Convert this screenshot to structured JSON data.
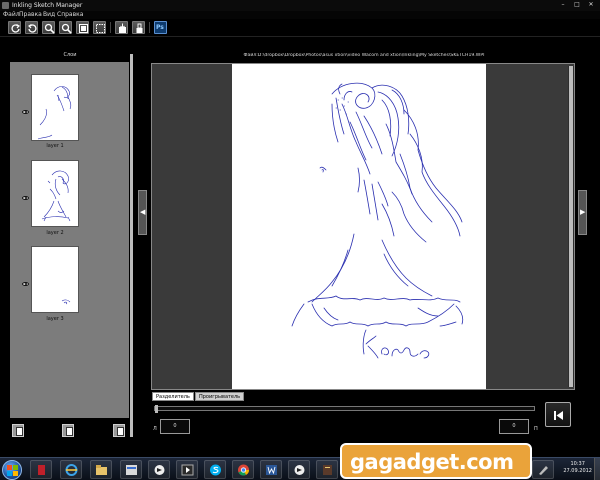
{
  "window": {
    "title": "Inkling Sketch Manager",
    "controls": {
      "minimize": "–",
      "maximize": "□",
      "close": "✕"
    }
  },
  "menu": [
    "Файл",
    "Правка",
    "Вид",
    "Справка"
  ],
  "toolbar": {
    "buttons": [
      {
        "name": "rotate-cw-icon"
      },
      {
        "name": "rotate-ccw-icon"
      },
      {
        "name": "zoom-in-icon"
      },
      {
        "name": "zoom-out-icon"
      },
      {
        "name": "fit-page-icon"
      },
      {
        "name": "actual-size-icon"
      },
      {
        "name": "save-icon"
      },
      {
        "name": "export-icon"
      },
      {
        "name": "photoshop-icon",
        "label": "Ps"
      }
    ]
  },
  "layers_panel": {
    "title": "Слои",
    "layers": [
      {
        "name": "layer 1"
      },
      {
        "name": "layer 2"
      },
      {
        "name": "layer 3"
      }
    ]
  },
  "main": {
    "file_path": "Файл:D:\\dropbox\\Dropbox\\Photos\\asus xtion\\video Wacom and xtion\\Inkling\\My Sketches\\SKETCH19.WPI",
    "tabs": [
      {
        "label": "Разделитель",
        "active": true
      },
      {
        "label": "Проигрыватель",
        "active": false
      }
    ],
    "counter_left": {
      "label": "Л",
      "value": "0"
    },
    "counter_right": {
      "label": "П",
      "value": "0"
    }
  },
  "taskbar": {
    "time": "10:37",
    "date": "27.09.2012",
    "watermark": "gagadget.com",
    "apps": [
      "explorer-icon",
      "ie-icon",
      "folder-icon",
      "file-manager-icon",
      "winamp-icon",
      "media-icon",
      "photoshop-icon",
      "skype-icon",
      "chrome-icon",
      "word-icon",
      "winamp-icon",
      "dictionary-icon",
      "inkling-icon"
    ]
  },
  "colors": {
    "ink": "#2a2fb0",
    "panel": "#7c7c7c",
    "background": "#000000"
  }
}
